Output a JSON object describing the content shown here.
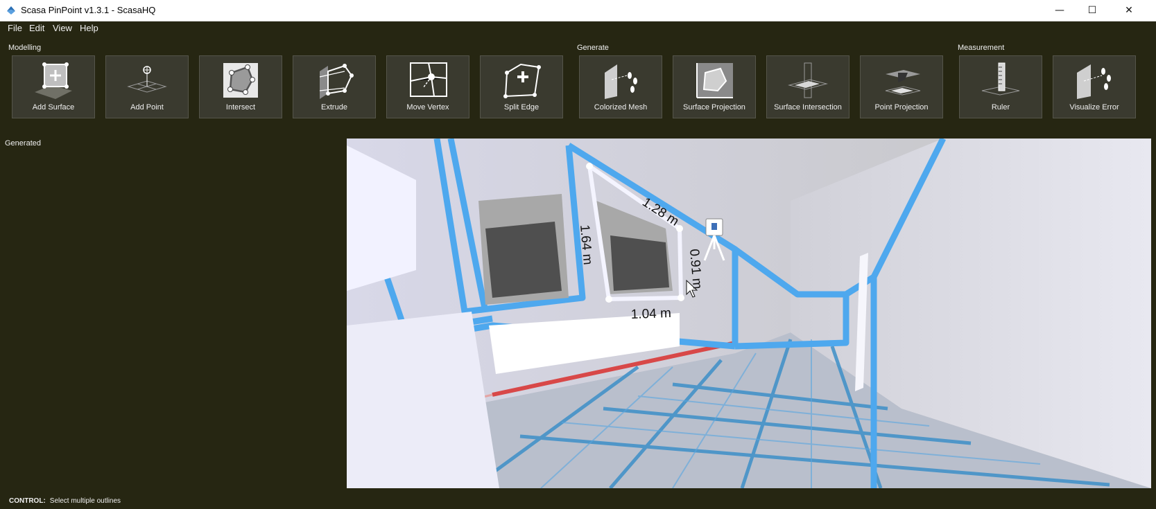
{
  "window": {
    "title": "Scasa PinPoint v1.3.1 - ScasaHQ",
    "controls": {
      "minimize": "—",
      "maximize": "☐",
      "close": "✕"
    }
  },
  "menu": {
    "items": [
      "File",
      "Edit",
      "View",
      "Help"
    ]
  },
  "toolbar": {
    "groups": [
      "Modelling",
      "Generate",
      "Measurement"
    ],
    "tools": [
      {
        "label": "Add Surface",
        "icon": "add-surface-icon"
      },
      {
        "label": "Add Point",
        "icon": "add-point-icon"
      },
      {
        "label": "Intersect",
        "icon": "intersect-icon"
      },
      {
        "label": "Extrude",
        "icon": "extrude-icon"
      },
      {
        "label": "Move Vertex",
        "icon": "move-vertex-icon"
      },
      {
        "label": "Split Edge",
        "icon": "split-edge-icon"
      },
      {
        "label": "Colorized Mesh",
        "icon": "colorized-mesh-icon"
      },
      {
        "label": "Surface Projection",
        "icon": "surface-projection-icon"
      },
      {
        "label": "Surface Intersection",
        "icon": "surface-intersection-icon"
      },
      {
        "label": "Point Projection",
        "icon": "point-projection-icon"
      },
      {
        "label": "Ruler",
        "icon": "ruler-icon"
      },
      {
        "label": "Visualize Error",
        "icon": "visualize-error-icon"
      }
    ]
  },
  "panel": {
    "label": "Generated"
  },
  "viewport": {
    "measurements": [
      "1.28 m",
      "1.64 m",
      "0.91 m",
      "1.04 m"
    ],
    "accent_color": "#4ea8ee",
    "floor_line_color": "#d84848"
  },
  "status": {
    "key": "CONTROL:",
    "text": "Select multiple outlines"
  }
}
